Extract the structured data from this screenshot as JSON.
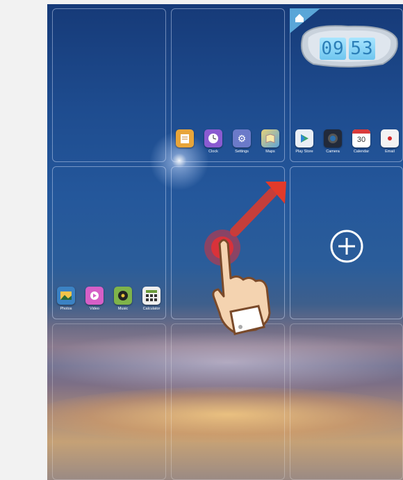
{
  "clock": {
    "hours": "09",
    "minutes": "53"
  },
  "dock_top": [
    {
      "name": "notes",
      "label": "",
      "color": "#e8a53a"
    },
    {
      "name": "clock",
      "label": "Clock",
      "color": "#8a5bd1"
    },
    {
      "name": "settings",
      "label": "Settings",
      "color": "#6b7ac9"
    },
    {
      "name": "maps",
      "label": "Maps",
      "color": "#e0c06a"
    },
    {
      "name": "play-store",
      "label": "Play Store",
      "color": "#e9eef5"
    },
    {
      "name": "camera",
      "label": "Camera",
      "color": "#222a3a"
    },
    {
      "name": "calendar",
      "label": "Calendar",
      "color": "#ffffff",
      "value": "30"
    },
    {
      "name": "email",
      "label": "Email",
      "color": "#f3f3f3"
    }
  ],
  "dock_bottom": [
    {
      "name": "photos",
      "label": "Photos",
      "color": "#3b82c4"
    },
    {
      "name": "video",
      "label": "Video",
      "color": "#d65fc7"
    },
    {
      "name": "music",
      "label": "Music",
      "color": "#7fb34a"
    },
    {
      "name": "calculator",
      "label": "Calculator",
      "color": "#eeeeee"
    }
  ],
  "colors": {
    "arrow": "#e23a2a",
    "touch": "#d9323a"
  }
}
